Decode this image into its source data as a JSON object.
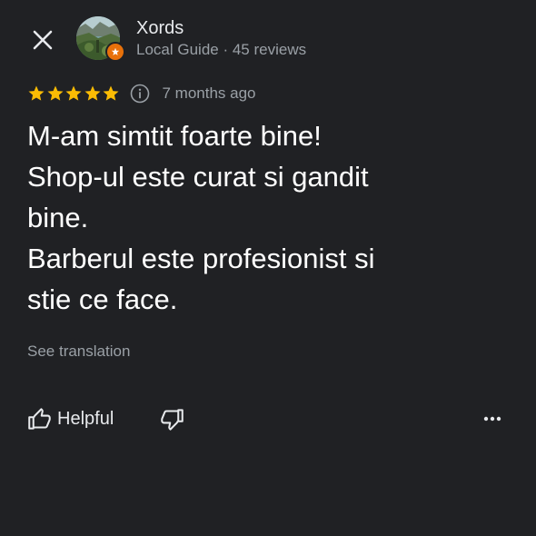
{
  "header": {
    "close_icon": "close-icon",
    "author": {
      "name": "Xords",
      "meta": "Local Guide · 45 reviews",
      "avatar_icon": "avatar-landscape",
      "badge_icon": "local-guide-badge-icon",
      "badge_color": "#e8710a"
    }
  },
  "review": {
    "rating": 5,
    "rating_max": 5,
    "star_color": "#fbbc04",
    "info_icon": "info-icon",
    "time_ago": "7 months ago",
    "text_lines": [
      "M-am simtit foarte bine!",
      "Shop-ul este curat si gandit",
      "bine.",
      "Barberul este profesionist si",
      "stie ce face."
    ],
    "see_translation": "See translation"
  },
  "actions": {
    "helpful_label": "Helpful",
    "helpful_icon": "thumbs-up-icon",
    "not_helpful_icon": "thumbs-down-icon",
    "more_icon": "more-horizontal-icon"
  },
  "colors": {
    "background": "#202124",
    "primary_text": "#ffffff",
    "secondary_text": "#9aa0a6"
  }
}
